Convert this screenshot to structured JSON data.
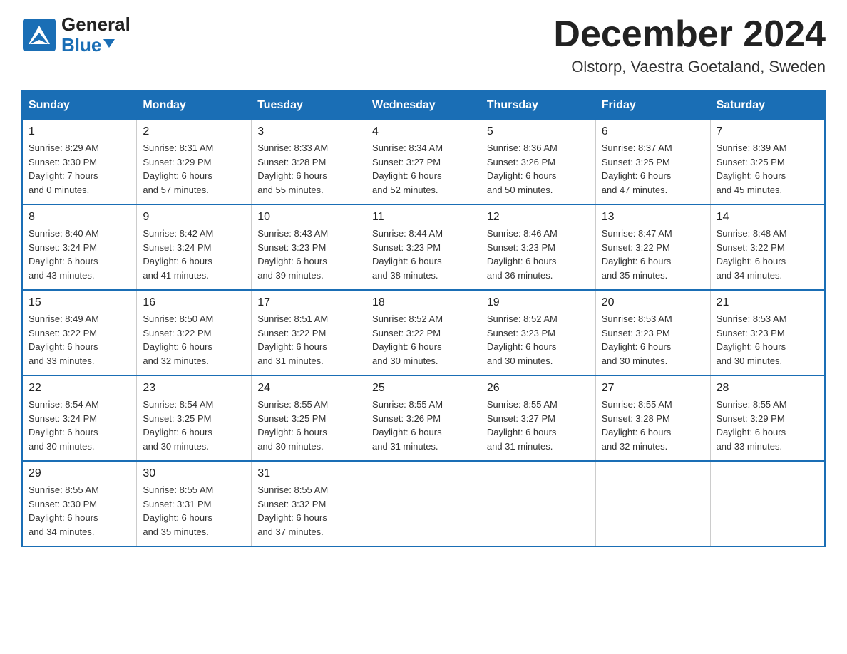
{
  "header": {
    "logo_general": "General",
    "logo_blue": "Blue",
    "month_title": "December 2024",
    "location": "Olstorp, Vaestra Goetaland, Sweden"
  },
  "days_of_week": [
    "Sunday",
    "Monday",
    "Tuesday",
    "Wednesday",
    "Thursday",
    "Friday",
    "Saturday"
  ],
  "weeks": [
    [
      {
        "day": "1",
        "sunrise": "8:29 AM",
        "sunset": "3:30 PM",
        "daylight": "7 hours and 0 minutes."
      },
      {
        "day": "2",
        "sunrise": "8:31 AM",
        "sunset": "3:29 PM",
        "daylight": "6 hours and 57 minutes."
      },
      {
        "day": "3",
        "sunrise": "8:33 AM",
        "sunset": "3:28 PM",
        "daylight": "6 hours and 55 minutes."
      },
      {
        "day": "4",
        "sunrise": "8:34 AM",
        "sunset": "3:27 PM",
        "daylight": "6 hours and 52 minutes."
      },
      {
        "day": "5",
        "sunrise": "8:36 AM",
        "sunset": "3:26 PM",
        "daylight": "6 hours and 50 minutes."
      },
      {
        "day": "6",
        "sunrise": "8:37 AM",
        "sunset": "3:25 PM",
        "daylight": "6 hours and 47 minutes."
      },
      {
        "day": "7",
        "sunrise": "8:39 AM",
        "sunset": "3:25 PM",
        "daylight": "6 hours and 45 minutes."
      }
    ],
    [
      {
        "day": "8",
        "sunrise": "8:40 AM",
        "sunset": "3:24 PM",
        "daylight": "6 hours and 43 minutes."
      },
      {
        "day": "9",
        "sunrise": "8:42 AM",
        "sunset": "3:24 PM",
        "daylight": "6 hours and 41 minutes."
      },
      {
        "day": "10",
        "sunrise": "8:43 AM",
        "sunset": "3:23 PM",
        "daylight": "6 hours and 39 minutes."
      },
      {
        "day": "11",
        "sunrise": "8:44 AM",
        "sunset": "3:23 PM",
        "daylight": "6 hours and 38 minutes."
      },
      {
        "day": "12",
        "sunrise": "8:46 AM",
        "sunset": "3:23 PM",
        "daylight": "6 hours and 36 minutes."
      },
      {
        "day": "13",
        "sunrise": "8:47 AM",
        "sunset": "3:22 PM",
        "daylight": "6 hours and 35 minutes."
      },
      {
        "day": "14",
        "sunrise": "8:48 AM",
        "sunset": "3:22 PM",
        "daylight": "6 hours and 34 minutes."
      }
    ],
    [
      {
        "day": "15",
        "sunrise": "8:49 AM",
        "sunset": "3:22 PM",
        "daylight": "6 hours and 33 minutes."
      },
      {
        "day": "16",
        "sunrise": "8:50 AM",
        "sunset": "3:22 PM",
        "daylight": "6 hours and 32 minutes."
      },
      {
        "day": "17",
        "sunrise": "8:51 AM",
        "sunset": "3:22 PM",
        "daylight": "6 hours and 31 minutes."
      },
      {
        "day": "18",
        "sunrise": "8:52 AM",
        "sunset": "3:22 PM",
        "daylight": "6 hours and 30 minutes."
      },
      {
        "day": "19",
        "sunrise": "8:52 AM",
        "sunset": "3:23 PM",
        "daylight": "6 hours and 30 minutes."
      },
      {
        "day": "20",
        "sunrise": "8:53 AM",
        "sunset": "3:23 PM",
        "daylight": "6 hours and 30 minutes."
      },
      {
        "day": "21",
        "sunrise": "8:53 AM",
        "sunset": "3:23 PM",
        "daylight": "6 hours and 30 minutes."
      }
    ],
    [
      {
        "day": "22",
        "sunrise": "8:54 AM",
        "sunset": "3:24 PM",
        "daylight": "6 hours and 30 minutes."
      },
      {
        "day": "23",
        "sunrise": "8:54 AM",
        "sunset": "3:25 PM",
        "daylight": "6 hours and 30 minutes."
      },
      {
        "day": "24",
        "sunrise": "8:55 AM",
        "sunset": "3:25 PM",
        "daylight": "6 hours and 30 minutes."
      },
      {
        "day": "25",
        "sunrise": "8:55 AM",
        "sunset": "3:26 PM",
        "daylight": "6 hours and 31 minutes."
      },
      {
        "day": "26",
        "sunrise": "8:55 AM",
        "sunset": "3:27 PM",
        "daylight": "6 hours and 31 minutes."
      },
      {
        "day": "27",
        "sunrise": "8:55 AM",
        "sunset": "3:28 PM",
        "daylight": "6 hours and 32 minutes."
      },
      {
        "day": "28",
        "sunrise": "8:55 AM",
        "sunset": "3:29 PM",
        "daylight": "6 hours and 33 minutes."
      }
    ],
    [
      {
        "day": "29",
        "sunrise": "8:55 AM",
        "sunset": "3:30 PM",
        "daylight": "6 hours and 34 minutes."
      },
      {
        "day": "30",
        "sunrise": "8:55 AM",
        "sunset": "3:31 PM",
        "daylight": "6 hours and 35 minutes."
      },
      {
        "day": "31",
        "sunrise": "8:55 AM",
        "sunset": "3:32 PM",
        "daylight": "6 hours and 37 minutes."
      },
      null,
      null,
      null,
      null
    ]
  ],
  "labels": {
    "sunrise": "Sunrise:",
    "sunset": "Sunset:",
    "daylight": "Daylight:"
  }
}
